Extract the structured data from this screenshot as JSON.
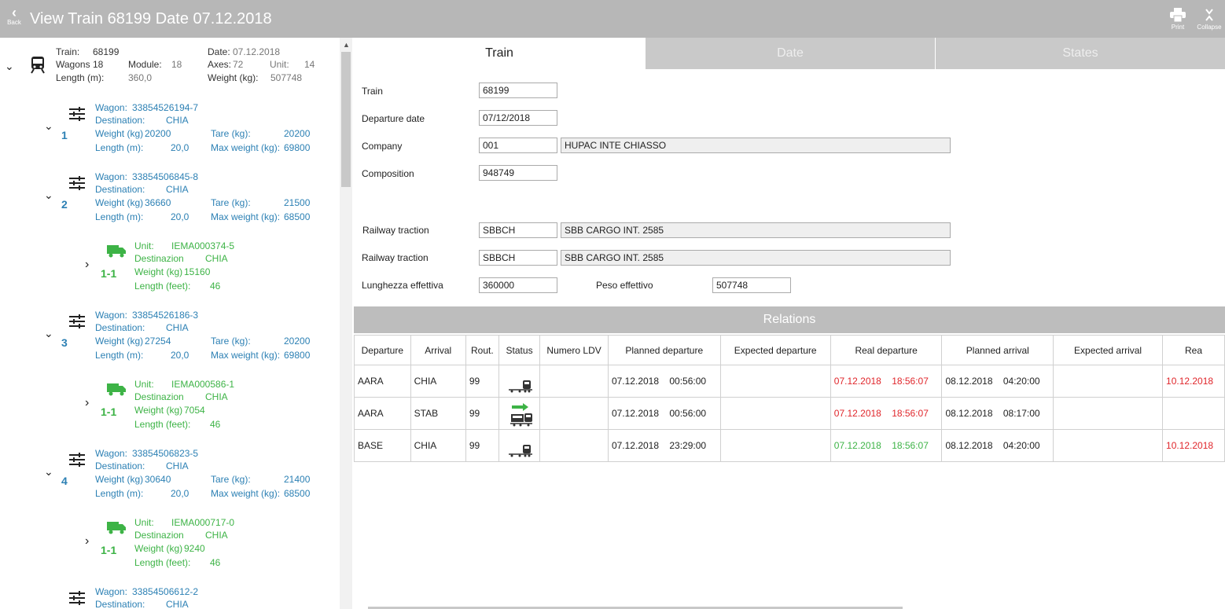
{
  "header": {
    "back_label": "Back",
    "title": "View Train 68199 Date 07.12.2018",
    "print_label": "Print",
    "collapse_label": "Collapse"
  },
  "train_summary": {
    "train_label": "Train:",
    "train_value": "68199",
    "date_label": "Date:",
    "date_value": "07.12.2018",
    "wagons_label": "Wagons",
    "wagons_value": "18",
    "module_label": "Module:",
    "module_value": "18",
    "axes_label": "Axes:",
    "axes_value": "72",
    "unit_label": "Unit:",
    "unit_value": "14",
    "length_label": "Length (m):",
    "length_value": "360,0",
    "weight_label": "Weight (kg):",
    "weight_value": "507748"
  },
  "wagon_labels": {
    "wagon": "Wagon:",
    "destination": "Destination:",
    "weight": "Weight (kg)",
    "tare": "Tare (kg):",
    "length": "Length (m):",
    "max_weight": "Max weight (kg):"
  },
  "unit_labels": {
    "unit": "Unit:",
    "destination": "Destinazion",
    "weight": "Weight (kg)",
    "length": "Length (feet):"
  },
  "wagons": [
    {
      "num": "1",
      "id": "33854526194-7",
      "dest": "CHIA",
      "weight": "20200",
      "tare": "20200",
      "length": "20,0",
      "max": "69800"
    },
    {
      "num": "2",
      "id": "33854506845-8",
      "dest": "CHIA",
      "weight": "36660",
      "tare": "21500",
      "length": "20,0",
      "max": "68500"
    },
    {
      "num": "3",
      "id": "33854526186-3",
      "dest": "CHIA",
      "weight": "27254",
      "tare": "20200",
      "length": "20,0",
      "max": "69800"
    },
    {
      "num": "4",
      "id": "33854506823-5",
      "dest": "CHIA",
      "weight": "30640",
      "tare": "21400",
      "length": "20,0",
      "max": "68500"
    },
    {
      "num": "",
      "id": "33854506612-2",
      "dest": "CHIA"
    }
  ],
  "units": [
    {
      "num": "1-1",
      "id": "IEMA000374-5",
      "dest": "CHIA",
      "weight": "15160",
      "length": "46"
    },
    {
      "num": "1-1",
      "id": "IEMA000586-1",
      "dest": "CHIA",
      "weight": "7054",
      "length": "46"
    },
    {
      "num": "1-1",
      "id": "IEMA000717-0",
      "dest": "CHIA",
      "weight": "9240",
      "length": "46"
    }
  ],
  "tabs": [
    "Train",
    "Date",
    "States"
  ],
  "form": {
    "train_label": "Train",
    "train_value": "68199",
    "departure_date_label": "Departure date",
    "departure_date_value": "07/12/2018",
    "company_label": "Company",
    "company_code": "001",
    "company_name": "HUPAC INTE CHIASSO",
    "composition_label": "Composition",
    "composition_value": "948749",
    "traction1_label": "Railway traction",
    "traction1_code": "SBBCH",
    "traction1_name": "SBB CARGO INT. 2585",
    "traction2_label": "Railway traction",
    "traction2_code": "SBBCH",
    "traction2_name": "SBB CARGO INT. 2585",
    "lunghezza_label": "Lunghezza effettiva",
    "lunghezza_value": "360000",
    "peso_label": "Peso effettivo",
    "peso_value": "507748"
  },
  "relations": {
    "title": "Relations",
    "columns": [
      "Departure",
      "Arrival",
      "Rout.",
      "Status",
      "Numero LDV",
      "Planned departure",
      "Expected departure",
      "Real departure",
      "Planned arrival",
      "Expected arrival",
      "Rea"
    ],
    "rows": [
      {
        "departure": "AARA",
        "arrival": "CHIA",
        "rout": "99",
        "status_icon": "train-icon",
        "ldv": "",
        "planned_dep": "07.12.2018    00:56:00",
        "expected_dep": "",
        "real_dep": "07.12.2018    18:56:07",
        "real_dep_color": "#e0262b",
        "planned_arr": "08.12.2018    04:20:00",
        "expected_arr": "",
        "real_arr": "10.12.2018",
        "real_arr_color": "#e0262b"
      },
      {
        "departure": "AARA",
        "arrival": "STAB",
        "rout": "99",
        "status_icon": "train-arrow-icon",
        "ldv": "",
        "planned_dep": "07.12.2018    00:56:00",
        "expected_dep": "",
        "real_dep": "07.12.2018    18:56:07",
        "real_dep_color": "#e0262b",
        "planned_arr": "08.12.2018    08:17:00",
        "expected_arr": "",
        "real_arr": "",
        "real_arr_color": "#e0262b"
      },
      {
        "departure": "BASE",
        "arrival": "CHIA",
        "rout": "99",
        "status_icon": "train-icon",
        "ldv": "",
        "planned_dep": "07.12.2018    23:29:00",
        "expected_dep": "",
        "real_dep": "07.12.2018    18:56:07",
        "real_dep_color": "#3db346",
        "planned_arr": "08.12.2018    04:20:00",
        "expected_arr": "",
        "real_arr": "10.12.2018",
        "real_arr_color": "#e0262b"
      }
    ]
  }
}
